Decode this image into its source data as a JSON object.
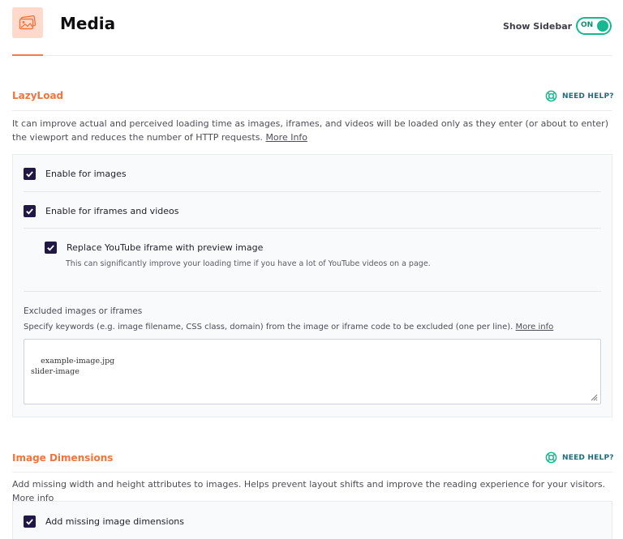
{
  "header": {
    "title": "Media",
    "show_sidebar_label": "Show Sidebar",
    "toggle_label": "ON",
    "icon": "image-icon",
    "accent_color": "#f37a4b",
    "toggle_color": "#16b88f"
  },
  "lazyload": {
    "title": "LazyLoad",
    "help_label": "NEED HELP?",
    "description": "It can improve actual and perceived loading time as images, iframes, and videos will be loaded only as they enter (or about to enter) the viewport and reduces the number of HTTP requests.",
    "more_info_label": "More Info",
    "options": [
      {
        "label": "Enable for images",
        "checked": true
      },
      {
        "label": "Enable for iframes and videos",
        "checked": true
      }
    ],
    "youtube": {
      "label": "Replace YouTube iframe with preview image",
      "sub": "This can significantly improve your loading time if you have a lot of YouTube videos on a page.",
      "checked": true
    },
    "excluded": {
      "label": "Excluded images or iframes",
      "description": "Specify keywords (e.g. image filename, CSS class, domain) from the image or iframe code to be excluded (one per line).",
      "more_info_label": "More info",
      "value": "example-image.jpg\nslider-image"
    }
  },
  "image_dimensions": {
    "title": "Image Dimensions",
    "help_label": "NEED HELP?",
    "description": "Add missing width and height attributes to images. Helps prevent layout shifts and improve the reading experience for your visitors.",
    "more_info_label": "More info",
    "option": {
      "label": "Add missing image dimensions",
      "checked": true
    }
  }
}
